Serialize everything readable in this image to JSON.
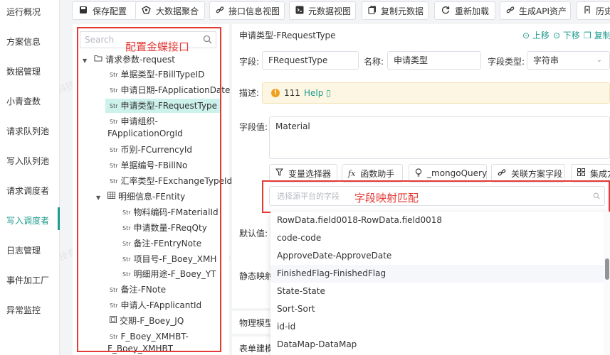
{
  "sidebar": {
    "items": [
      {
        "label": "运行概况"
      },
      {
        "label": "方案信息"
      },
      {
        "label": "数据管理"
      },
      {
        "label": "小青查数"
      },
      {
        "label": "请求队列池"
      },
      {
        "label": "写入队列池"
      },
      {
        "label": "请求调度者"
      },
      {
        "label": "写入调度者"
      },
      {
        "label": "日志管理"
      },
      {
        "label": "事件加工厂"
      },
      {
        "label": "异常监控"
      }
    ],
    "active_index": 7
  },
  "toolbar": {
    "buttons": [
      {
        "label": "保存配置",
        "icon": "save-icon"
      },
      {
        "label": "大数据聚合",
        "icon": "aggregate-icon"
      },
      {
        "label": "接口信息视图",
        "icon": "link-icon"
      },
      {
        "label": "元数据视图",
        "icon": "terminal-icon"
      },
      {
        "label": "复制元数据",
        "icon": "copy-icon"
      },
      {
        "label": "重新加载",
        "icon": "reload-icon"
      },
      {
        "label": "生成API资产",
        "icon": "api-asset-icon"
      },
      {
        "label": "历史",
        "icon": "history-icon"
      }
    ]
  },
  "tree": {
    "search_placeholder": "Search",
    "annotation": "配置金蝶接口",
    "nodes": [
      {
        "type": "folder",
        "label": "请求参数-request"
      },
      {
        "type": "Str",
        "label": "单据类型-FBillTypeID"
      },
      {
        "type": "Str",
        "label": "申请日期-FApplicationDate"
      },
      {
        "type": "Str",
        "label": "申请类型-FRequestType"
      },
      {
        "type": "Str",
        "label": "申请组织-",
        "label2": "FApplicationOrgId"
      },
      {
        "type": "Str",
        "label": "币别-FCurrencyId"
      },
      {
        "type": "Str",
        "label": "单据编号-FBillNo"
      },
      {
        "type": "Str",
        "label": "汇率类型-FExchangeTypeId"
      },
      {
        "type": "table",
        "label": "明细信息-FEntity"
      },
      {
        "type": "Str",
        "label": "物料编码-FMaterialId"
      },
      {
        "type": "Str",
        "label": "申请数量-FReqQty"
      },
      {
        "type": "Str",
        "label": "备注-FEntryNote"
      },
      {
        "type": "Str",
        "label": "项目号-F_Boey_XMH"
      },
      {
        "type": "Str",
        "label": "明细用途-F_Boey_YT"
      },
      {
        "type": "Str",
        "label": "备注-FNote"
      },
      {
        "type": "Str",
        "label": "申请人-FApplicantId"
      },
      {
        "type": "dict",
        "label": "交期-F_Boey_JQ"
      },
      {
        "type": "Str",
        "label": "F_Boey_XMHBT-",
        "label2": "F_Boey_XMHBT"
      }
    ]
  },
  "detail": {
    "title": "申请类型-FRequestType",
    "nav": {
      "up": "上移",
      "down": "下移",
      "copy": "复制"
    },
    "field_label": "字段:",
    "field_value": "FRequestType",
    "name_label": "名称:",
    "name_value": "申请类型",
    "type_label": "字段类型:",
    "type_value": "字符串",
    "desc_label": "描述:",
    "desc_value": "111",
    "desc_help": "Help",
    "value_label": "字段值:",
    "value_text": "Material",
    "default_label": "默认值:",
    "static_label": "静态映射",
    "buttons": [
      {
        "label": "变量选择器",
        "icon": "filter-icon"
      },
      {
        "label": "函数助手",
        "icon": "function-icon"
      },
      {
        "label": "_mongoQuery",
        "icon": "bulb-icon"
      },
      {
        "label": "关联方案字段",
        "icon": "link-icon"
      },
      {
        "label": "集成方",
        "icon": "grid-icon"
      }
    ]
  },
  "dropdown": {
    "placeholder": "选择源平台的字段",
    "annotation": "字段映射匹配",
    "options": [
      "RowData.field0018-RowData.field0018",
      "code-code",
      "ApproveDate-ApproveDate",
      "FinishedFlag-FinishedFlag",
      "State-State",
      "Sort-Sort",
      "id-id",
      "DataMap-DataMap"
    ],
    "hover_index": 3
  },
  "bottom_cards": [
    "物理模型",
    "表单建模"
  ],
  "watermark": "广东轻亿云软件科技有限公司",
  "colors": {
    "accent": "#1f9b8f",
    "annotation": "#e53935",
    "selected_bg": "#cdf1eb"
  }
}
